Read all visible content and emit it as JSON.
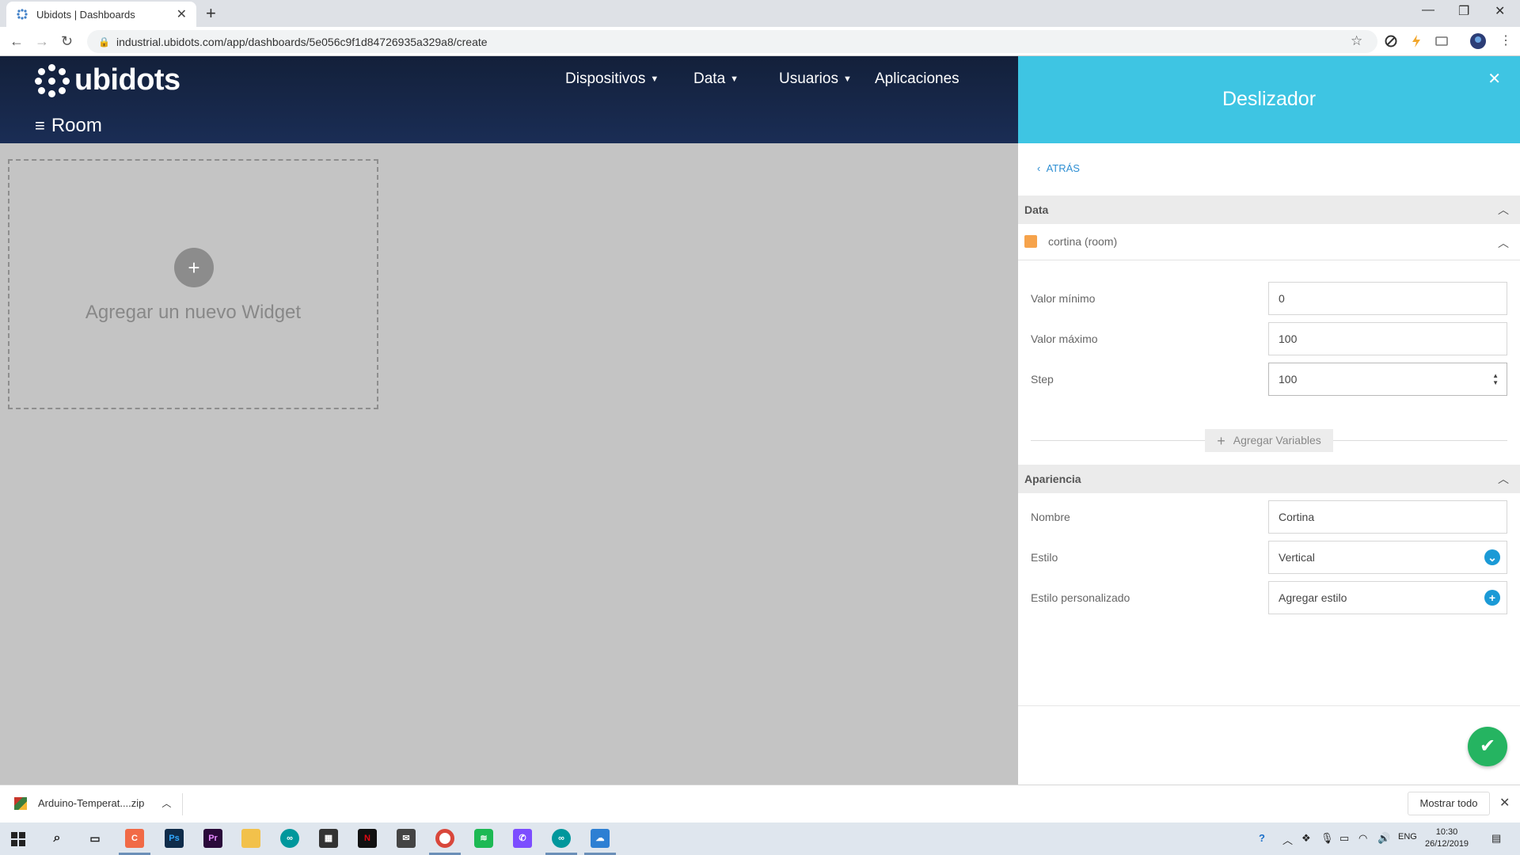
{
  "browser": {
    "tab_title": "Ubidots | Dashboards",
    "new_tab": "+",
    "url": "industrial.ubidots.com/app/dashboards/5e056c9f1d84726935a329a8/create"
  },
  "app": {
    "logo_text": "ubidots",
    "nav": [
      {
        "label": "Dispositivos"
      },
      {
        "label": "Data"
      },
      {
        "label": "Usuarios"
      },
      {
        "label": "Aplicaciones"
      }
    ],
    "dashboard_name": "Room",
    "add_widget_label": "Agregar un nuevo Widget"
  },
  "panel": {
    "title": "Deslizador",
    "back_label": "ATRÁS",
    "data_section": "Data",
    "variable": {
      "label": "cortina (room)",
      "color": "#f6a34b"
    },
    "fields": {
      "min_label": "Valor mínimo",
      "min_value": "0",
      "max_label": "Valor máximo",
      "max_value": "100",
      "step_label": "Step",
      "step_value": "100"
    },
    "add_variables": "Agregar Variables",
    "appearance_section": "Apariencia",
    "appearance": {
      "name_label": "Nombre",
      "name_value": "Cortina",
      "style_label": "Estilo",
      "style_value": "Vertical",
      "custom_label": "Estilo personalizado",
      "custom_value": "Agregar estilo"
    }
  },
  "download": {
    "file_name": "Arduino-Temperat....zip",
    "show_all": "Mostrar todo"
  },
  "taskbar": {
    "lang": "ENG",
    "time": "10:30",
    "date": "26/12/2019"
  },
  "colors": {
    "panel_header": "#3ec5e3",
    "app_header": "#13203a",
    "confirm": "#25b461",
    "accent": "#1b9ad6"
  }
}
